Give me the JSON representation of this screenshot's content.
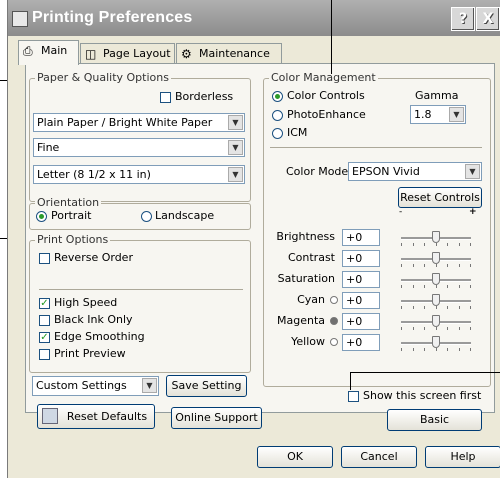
{
  "window": {
    "title": "Printing Preferences",
    "help_glyph": "?",
    "close_glyph": "X"
  },
  "tabs": [
    {
      "label": "Main",
      "icon": "printer-icon"
    },
    {
      "label": "Page Layout",
      "icon": "page-layout-icon"
    },
    {
      "label": "Maintenance",
      "icon": "maintenance-icon"
    }
  ],
  "paper_quality": {
    "group_label": "Paper & Quality Options",
    "borderless_label": "Borderless",
    "borderless_checked": false,
    "paper_type": "Plain Paper / Bright White Paper",
    "quality": "Fine",
    "paper_size": "Letter (8 1/2 x 11 in)"
  },
  "orientation": {
    "group_label": "Orientation",
    "portrait": "Portrait",
    "landscape": "Landscape",
    "selected": "Portrait"
  },
  "print_options": {
    "group_label": "Print Options",
    "reverse_order": "Reverse Order",
    "high_speed": "High Speed",
    "black_ink_only": "Black Ink Only",
    "edge_smoothing": "Edge Smoothing",
    "print_preview": "Print Preview",
    "checked": {
      "reverse_order": false,
      "high_speed": true,
      "black_ink_only": false,
      "edge_smoothing": true,
      "print_preview": false
    }
  },
  "custom_settings": {
    "value": "Custom Settings",
    "save_label": "Save Setting"
  },
  "color_management": {
    "group_label": "Color Management",
    "color_controls": "Color Controls",
    "photo_enhance": "PhotoEnhance",
    "icm": "ICM",
    "selected": "Color Controls",
    "gamma_label": "Gamma",
    "gamma_value": "1.8",
    "color_mode_label": "Color Mode",
    "color_mode_value": "EPSON Vivid",
    "reset_controls": "Reset Controls",
    "slider_min": "-",
    "slider_max": "+",
    "sliders": [
      {
        "label": "Brightness",
        "value": "+0",
        "dot": ""
      },
      {
        "label": "Contrast",
        "value": "+0",
        "dot": ""
      },
      {
        "label": "Saturation",
        "value": "+0",
        "dot": ""
      },
      {
        "label": "Cyan",
        "value": "+0",
        "dot": "#ffffff"
      },
      {
        "label": "Magenta",
        "value": "+0",
        "dot": "#707070"
      },
      {
        "label": "Yellow",
        "value": "+0",
        "dot": "#ffffff"
      }
    ]
  },
  "show_first": {
    "label": "Show this screen first",
    "checked": false
  },
  "bottom": {
    "reset_defaults": "Reset Defaults",
    "online_support": "Online Support",
    "basic": "Basic",
    "ok": "OK",
    "cancel": "Cancel",
    "help": "Help"
  }
}
